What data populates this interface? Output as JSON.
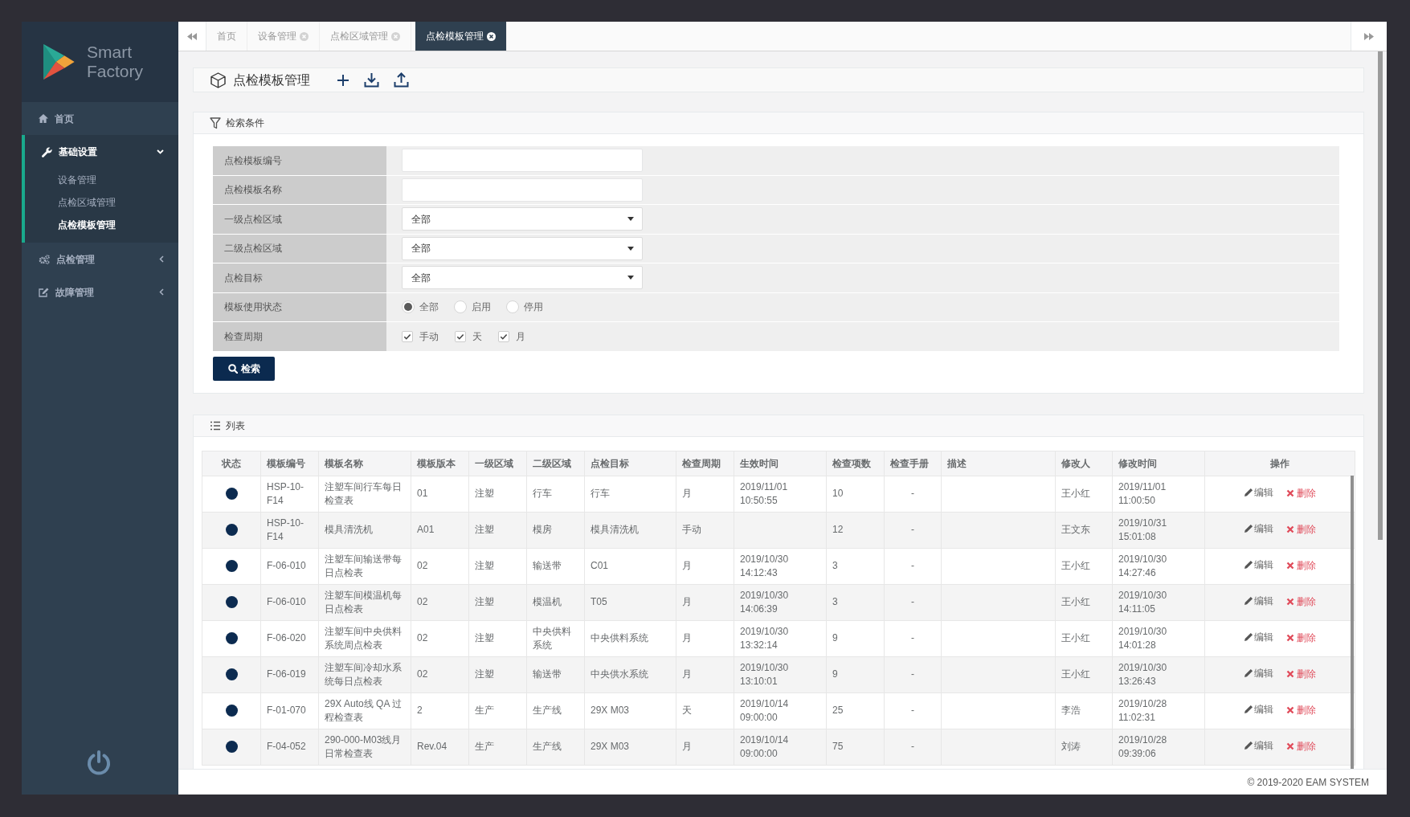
{
  "window": {
    "brand": "Smart Factory"
  },
  "sidebar": {
    "items": [
      {
        "kind": "link",
        "label": "首页"
      },
      {
        "kind": "group",
        "label": "基础设置",
        "expanded": true,
        "children": [
          {
            "label": "设备管理",
            "selected": false
          },
          {
            "label": "点检区域管理",
            "selected": false
          },
          {
            "label": "点检模板管理",
            "selected": true
          }
        ]
      },
      {
        "kind": "group",
        "label": "点检管理",
        "expanded": false
      },
      {
        "kind": "group",
        "label": "故障管理",
        "expanded": false
      }
    ]
  },
  "tabs": [
    {
      "label": "首页",
      "closable": false,
      "selected": false
    },
    {
      "label": "设备管理",
      "closable": true,
      "selected": false
    },
    {
      "label": "点检区域管理",
      "closable": true,
      "selected": false
    },
    {
      "label": "点检模板管理",
      "closable": true,
      "selected": true
    }
  ],
  "page_header": {
    "title": "点检模板管理"
  },
  "search": {
    "title": "检索条件",
    "fields": [
      {
        "kind": "text",
        "label": "点检模板编号"
      },
      {
        "kind": "text",
        "label": "点检模板名称"
      },
      {
        "kind": "select",
        "label": "一级点检区域",
        "value": "全部"
      },
      {
        "kind": "select",
        "label": "二级点检区域",
        "value": "全部"
      },
      {
        "kind": "select",
        "label": "点检目标",
        "value": "全部"
      },
      {
        "kind": "radio",
        "label": "模板使用状态",
        "options": [
          {
            "label": "全部",
            "selected": true
          },
          {
            "label": "启用",
            "selected": false
          },
          {
            "label": "停用",
            "selected": false
          }
        ]
      },
      {
        "kind": "checkbox",
        "label": "检查周期",
        "options": [
          {
            "label": "手动",
            "checked": true
          },
          {
            "label": "天",
            "checked": true
          },
          {
            "label": "月",
            "checked": true
          }
        ]
      }
    ],
    "button": "检索"
  },
  "list": {
    "title": "列表",
    "columns": [
      "状态",
      "模板编号",
      "模板名称",
      "模板版本",
      "一级区域",
      "二级区域",
      "点检目标",
      "检查周期",
      "生效时间",
      "检查项数",
      "检查手册",
      "描述",
      "修改人",
      "修改时间",
      "操作"
    ],
    "rows": [
      {
        "code": "HSP-10-F14",
        "name": "注塑车间行车每日检查表",
        "version": "01",
        "area_1": "注塑",
        "area_2": "行车",
        "target": "行车",
        "cycle": "月",
        "effective_time": "2019/11/01 10:50:55",
        "item_count": "10",
        "manual": "-",
        "modifier": "王小红",
        "modified_time": "2019/11/01 11:00:50",
        "actions": [
          {
            "kind": "edit",
            "label": "编辑"
          },
          {
            "kind": "delete",
            "label": "删除"
          }
        ]
      },
      {
        "code": "HSP-10-F14",
        "name": "模具清洗机",
        "version": "A01",
        "area_1": "注塑",
        "area_2": "模房",
        "target": "模具清洗机",
        "cycle": "手动",
        "item_count": "12",
        "manual": "-",
        "modifier": "王文东",
        "modified_time": "2019/10/31 15:01:08",
        "actions": [
          {
            "kind": "edit",
            "label": "编辑"
          },
          {
            "kind": "delete",
            "label": "删除"
          }
        ]
      },
      {
        "code": "F-06-010",
        "name": "注塑车间输送带每日点检表",
        "version": "02",
        "area_1": "注塑",
        "area_2": "输送带",
        "target": "C01",
        "cycle": "月",
        "effective_time": "2019/10/30 14:12:43",
        "item_count": "3",
        "manual": "-",
        "modifier": "王小红",
        "modified_time": "2019/10/30 14:27:46",
        "actions": [
          {
            "kind": "edit",
            "label": "编辑"
          },
          {
            "kind": "delete",
            "label": "删除"
          }
        ]
      },
      {
        "code": "F-06-010",
        "name": "注塑车间模温机每日点检表",
        "version": "02",
        "area_1": "注塑",
        "area_2": "模温机",
        "target": "T05",
        "cycle": "月",
        "effective_time": "2019/10/30 14:06:39",
        "item_count": "3",
        "manual": "-",
        "modifier": "王小红",
        "modified_time": "2019/10/30 14:11:05",
        "actions": [
          {
            "kind": "edit",
            "label": "编辑"
          },
          {
            "kind": "delete",
            "label": "删除"
          }
        ]
      },
      {
        "code": "F-06-020",
        "name": "注塑车间中央供料系统周点检表",
        "version": "02",
        "area_1": "注塑",
        "area_2": "中央供料系统",
        "target": "中央供料系统",
        "cycle": "月",
        "effective_time": "2019/10/30 13:32:14",
        "item_count": "9",
        "manual": "-",
        "modifier": "王小红",
        "modified_time": "2019/10/30 14:01:28",
        "actions": [
          {
            "kind": "edit",
            "label": "编辑"
          },
          {
            "kind": "delete",
            "label": "删除"
          }
        ]
      },
      {
        "code": "F-06-019",
        "name": "注塑车间冷却水系统每日点检表",
        "version": "02",
        "area_1": "注塑",
        "area_2": "输送带",
        "target": "中央供水系统",
        "cycle": "月",
        "effective_time": "2019/10/30 13:10:01",
        "item_count": "9",
        "manual": "-",
        "modifier": "王小红",
        "modified_time": "2019/10/30 13:26:43",
        "actions": [
          {
            "kind": "edit",
            "label": "编辑"
          },
          {
            "kind": "delete",
            "label": "删除"
          }
        ]
      },
      {
        "code": "F-01-070",
        "name": "29X Auto线 QA 过程检查表",
        "version": "2",
        "area_1": "生产",
        "area_2": "生产线",
        "target": "29X M03",
        "cycle": "天",
        "effective_time": "2019/10/14 09:00:00",
        "item_count": "25",
        "manual": "-",
        "modifier": "李浩",
        "modified_time": "2019/10/28 11:02:31",
        "actions": [
          {
            "kind": "edit",
            "label": "编辑"
          },
          {
            "kind": "delete",
            "label": "删除"
          }
        ]
      },
      {
        "code": "F-04-052",
        "name": "290-000-M03线月日常检查表",
        "version": "Rev.04",
        "area_1": "生产",
        "area_2": "生产线",
        "target": "29X M03",
        "cycle": "月",
        "effective_time": "2019/10/14 09:00:00",
        "item_count": "75",
        "manual": "-",
        "modifier": "刘涛",
        "modified_time": "2019/10/28 09:39:06",
        "actions": [
          {
            "kind": "edit",
            "label": "编辑"
          },
          {
            "kind": "delete",
            "label": "删除"
          }
        ]
      }
    ]
  },
  "footer": {
    "text": "© 2019-2020 EAM SYSTEM"
  }
}
